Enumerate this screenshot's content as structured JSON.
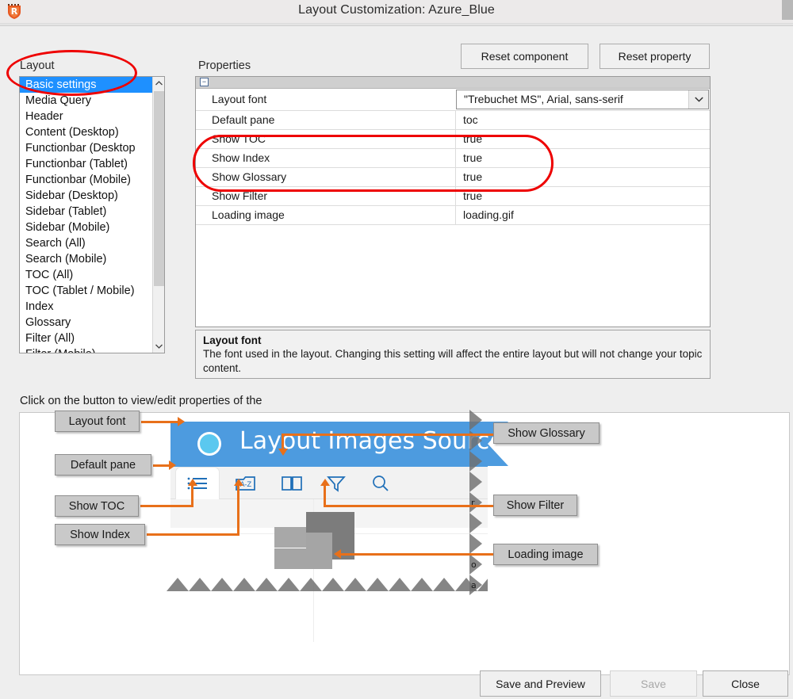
{
  "window": {
    "title": "Layout Customization: Azure_Blue",
    "app_icon": "robohelp-shield-icon"
  },
  "toolbar": {
    "reset_component_label": "Reset component",
    "reset_property_label": "Reset property"
  },
  "labels": {
    "layout": "Layout",
    "properties": "Properties",
    "hint": "Click on the button to view/edit properties of the"
  },
  "layout_list": {
    "selected": "Basic settings",
    "items": [
      "Basic settings",
      "Media Query",
      "Header",
      "Content (Desktop)",
      "Functionbar (Desktop",
      "Functionbar (Tablet)",
      "Functionbar (Mobile)",
      "Sidebar (Desktop)",
      "Sidebar (Tablet)",
      "Sidebar (Mobile)",
      "Search (All)",
      "Search (Mobile)",
      "TOC (All)",
      "TOC (Tablet / Mobile)",
      "Index",
      "Glossary",
      "Filter (All)",
      "Filter (Mobile)"
    ]
  },
  "properties": {
    "rows": [
      {
        "name": "Layout font",
        "value": "\"Trebuchet MS\", Arial, sans-serif",
        "editing": true
      },
      {
        "name": "Default pane",
        "value": "toc",
        "editing": false
      },
      {
        "name": "Show TOC",
        "value": "true",
        "editing": false
      },
      {
        "name": "Show Index",
        "value": "true",
        "editing": false
      },
      {
        "name": "Show Glossary",
        "value": "true",
        "editing": false
      },
      {
        "name": "Show Filter",
        "value": "true",
        "editing": false
      },
      {
        "name": "Loading image",
        "value": "loading.gif",
        "editing": false
      }
    ]
  },
  "description": {
    "title": "Layout font",
    "body": "The font used in the layout. Changing this setting will affect the entire layout but will not change your topic content."
  },
  "preview": {
    "banner_title": "Layout Images Source",
    "banner_color": "#4d9bdf",
    "callouts": {
      "layout_font": "Layout font",
      "default_pane": "Default pane",
      "show_toc": "Show TOC",
      "show_index": "Show Index",
      "show_glossary": "Show Glossary",
      "show_filter": "Show Filter",
      "loading_image": "Loading image"
    },
    "icons": [
      "toc-list-icon",
      "index-az-icon",
      "glossary-book-icon",
      "filter-funnel-icon",
      "search-magnifier-icon"
    ]
  },
  "footer": {
    "save_and_preview_label": "Save and Preview",
    "save_label": "Save",
    "save_enabled": false,
    "close_label": "Close"
  },
  "colors": {
    "accent_orange": "#e8701a",
    "annotation_red": "#ee0000",
    "selection_blue": "#1e90ff",
    "banner_blue": "#4d9bdf"
  }
}
